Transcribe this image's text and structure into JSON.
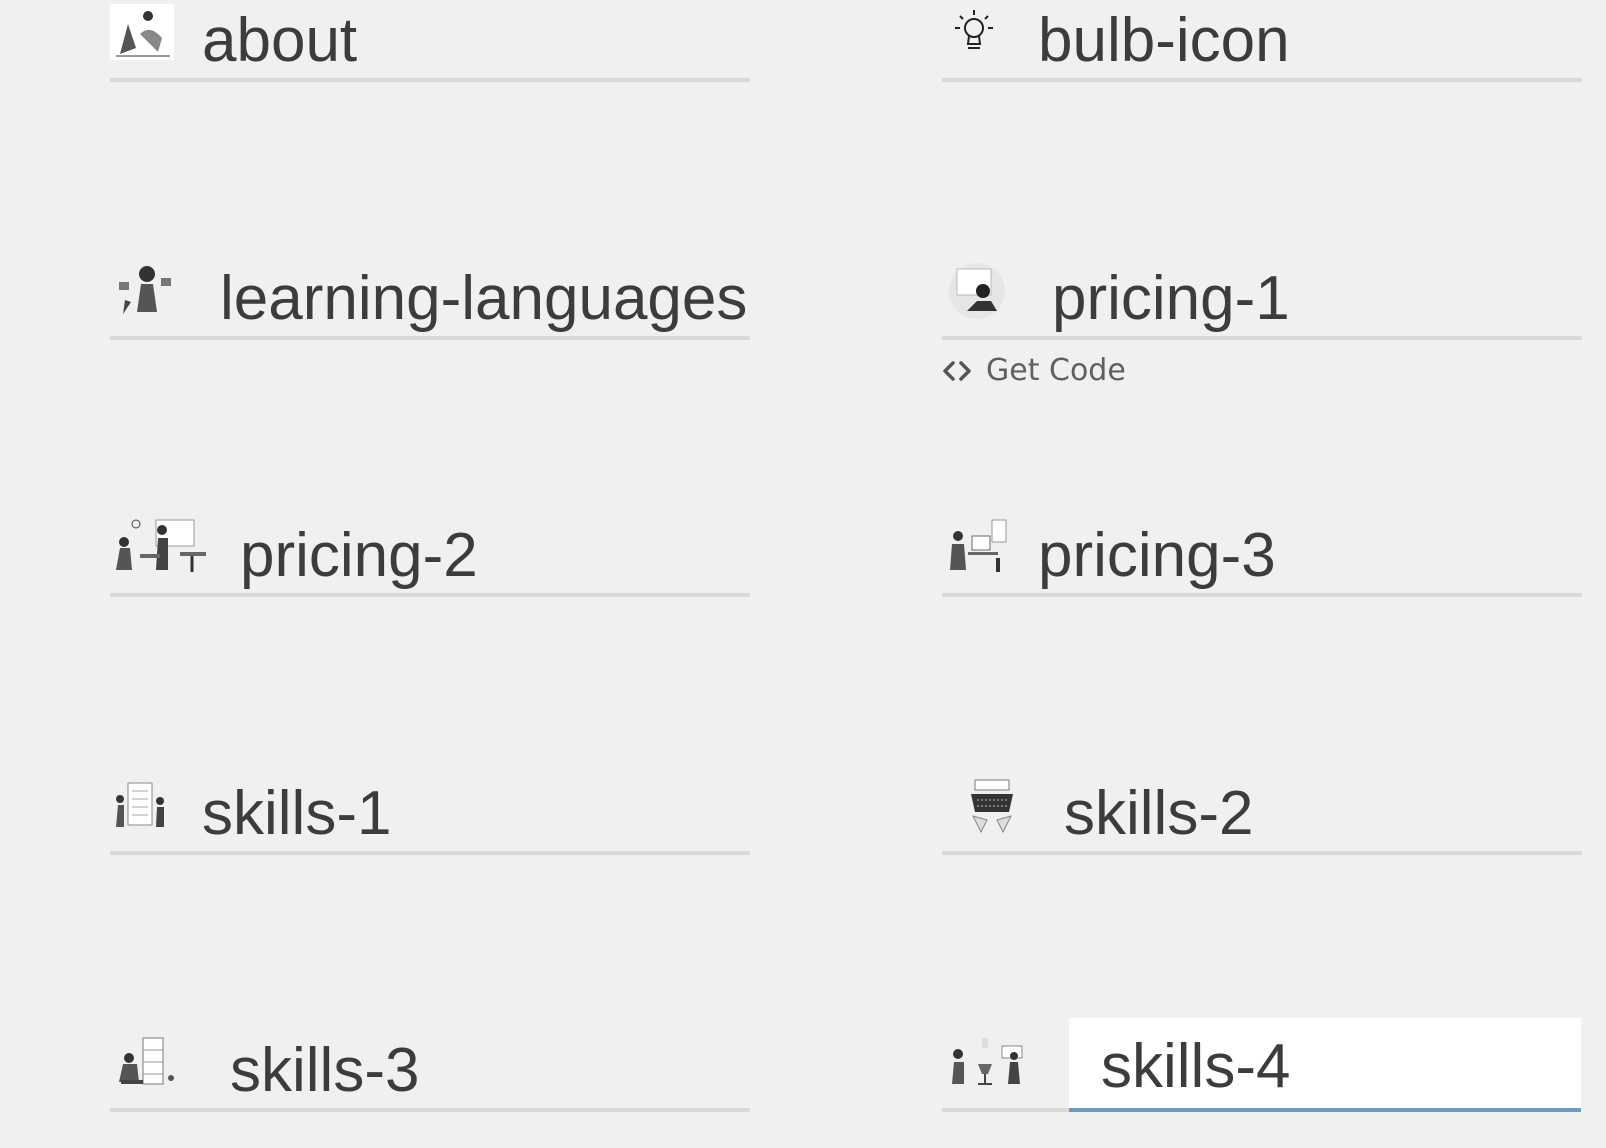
{
  "items": [
    {
      "key": "about",
      "label": "about",
      "icon": "people-illustration-icon"
    },
    {
      "key": "bulb-icon",
      "label": "bulb-icon",
      "icon": "lightbulb-icon"
    },
    {
      "key": "learning-languages",
      "label": "learning-languages",
      "icon": "people-illustration-icon"
    },
    {
      "key": "pricing-1",
      "label": "pricing-1",
      "icon": "people-illustration-icon"
    },
    {
      "key": "pricing-2",
      "label": "pricing-2",
      "icon": "people-illustration-icon"
    },
    {
      "key": "pricing-3",
      "label": "pricing-3",
      "icon": "people-illustration-icon"
    },
    {
      "key": "skills-1",
      "label": "skills-1",
      "icon": "people-illustration-icon"
    },
    {
      "key": "skills-2",
      "label": "skills-2",
      "icon": "typewriter-illustration-icon"
    },
    {
      "key": "skills-3",
      "label": "skills-3",
      "icon": "people-illustration-icon"
    },
    {
      "key": "skills-4",
      "label": "skills-4",
      "icon": "people-illustration-icon",
      "active": true
    }
  ],
  "get_code": {
    "label": "Get Code",
    "icon": "code-brackets-icon"
  },
  "colors": {
    "background": "#f0f0f0",
    "text": "#3c3c3c",
    "underline": "#d9d9d9",
    "active_underline": "#6f9ac6"
  }
}
